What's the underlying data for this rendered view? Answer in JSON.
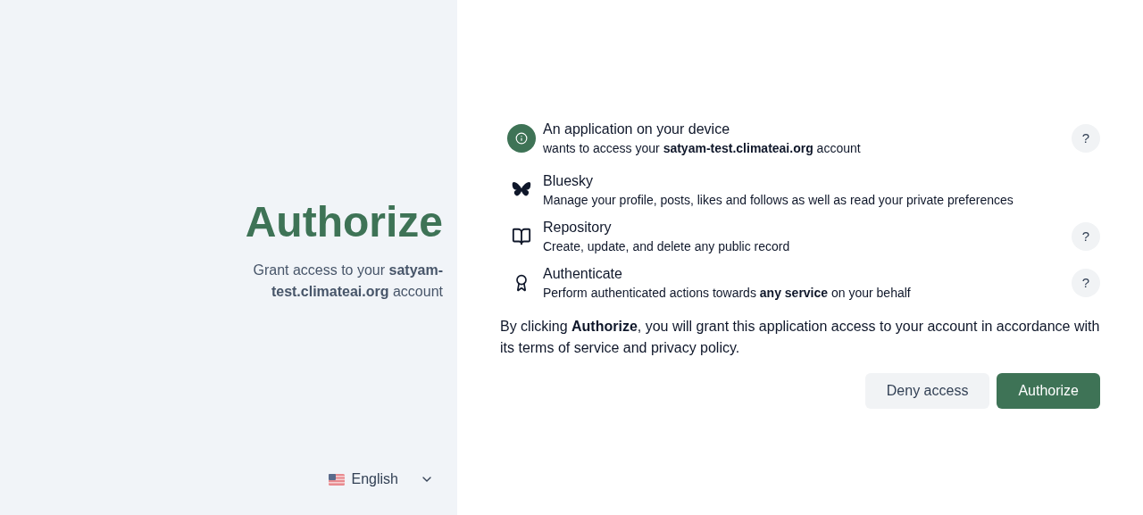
{
  "sidebar": {
    "title": "Authorize",
    "subtitle": "Grant access to your **satyam-test.climateai.org** account",
    "language": "English"
  },
  "permissions": [
    {
      "kind": "app",
      "title": "An application on your device",
      "description": "wants to access your **satyam-test.climateai.org** account",
      "help": "?"
    },
    {
      "kind": "bluesky",
      "title": "Bluesky",
      "description": "Manage your profile, posts, likes and follows as well as read your private preferences"
    },
    {
      "kind": "repository",
      "title": "Repository",
      "description": "Create, update, and delete any public record",
      "help": "?"
    },
    {
      "kind": "authenticate",
      "title": "Authenticate",
      "description": "Perform authenticated actions towards **any service** on your behalf",
      "help": "?"
    }
  ],
  "notice": "By clicking **Authorize**, you will grant this application access to your account in accordance with its terms of service and privacy policy.",
  "buttons": [
    {
      "kind": "secondary",
      "label": "Deny access"
    },
    {
      "kind": "primary",
      "label": "Authorize"
    }
  ]
}
